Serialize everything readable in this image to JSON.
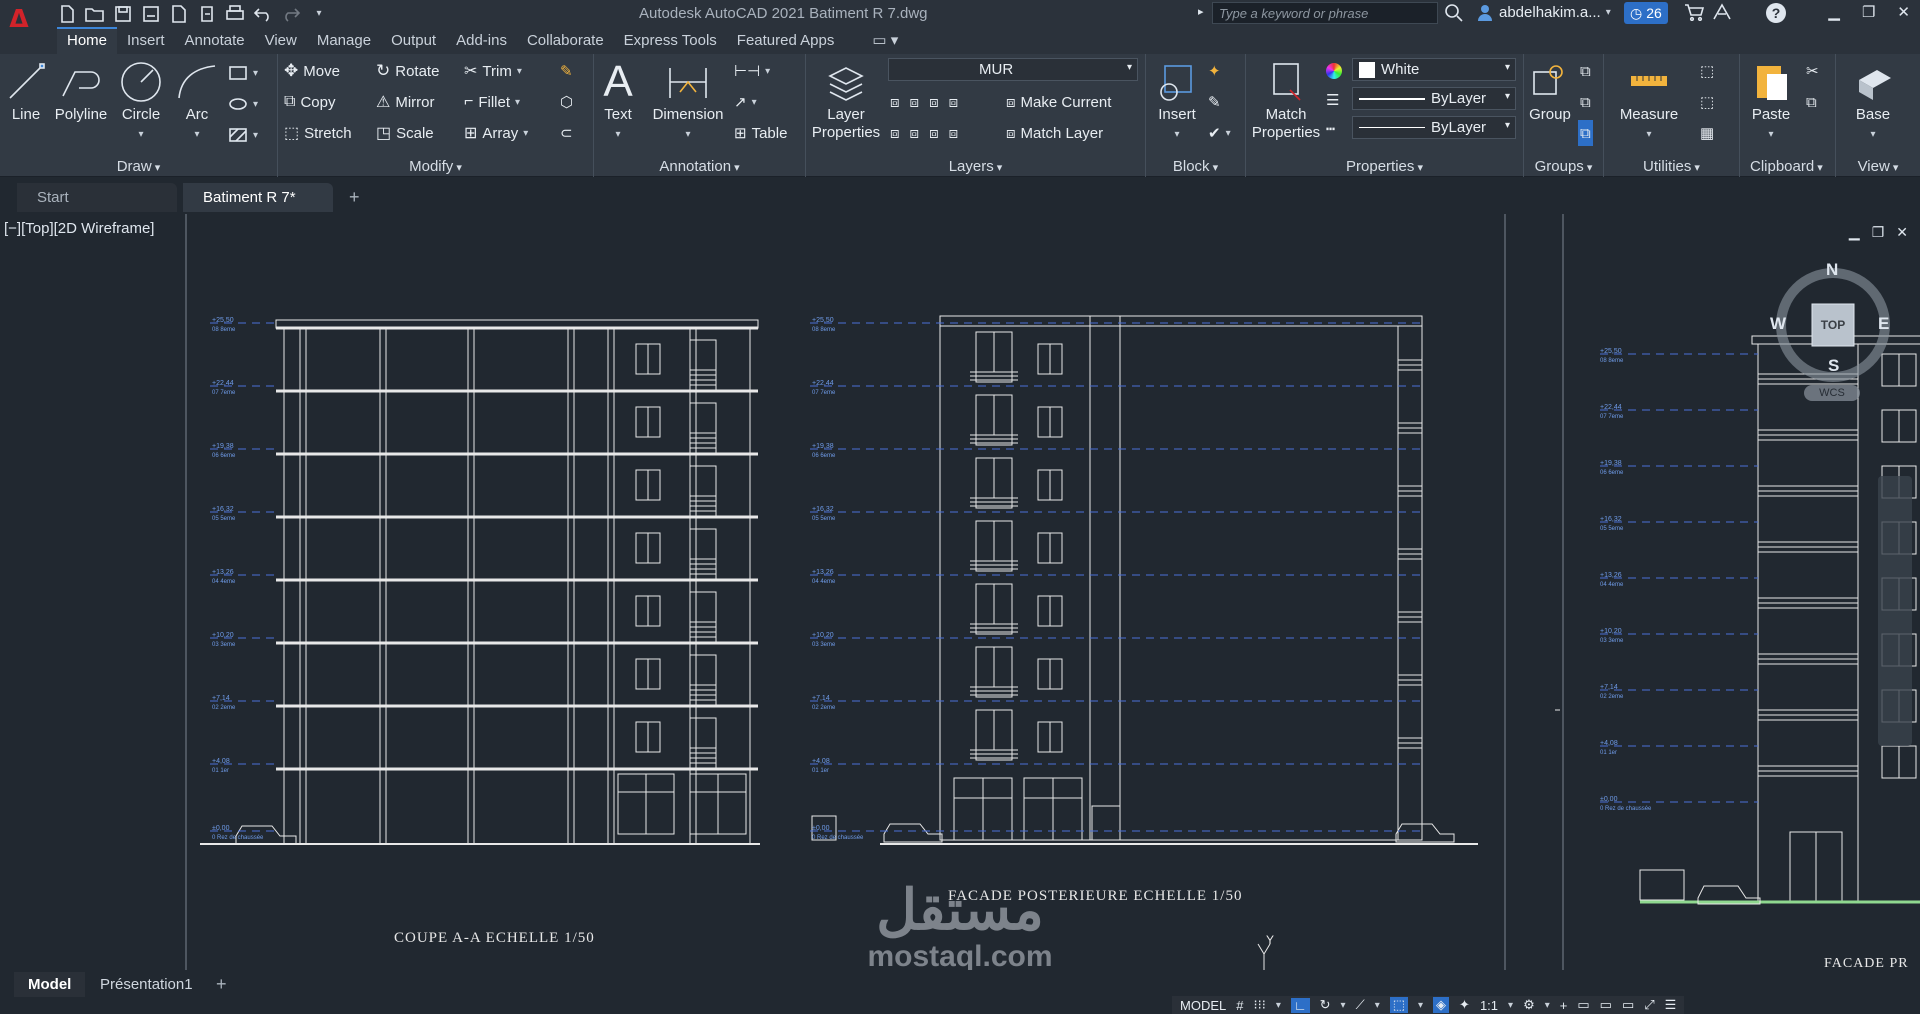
{
  "app": {
    "logo_letter": "A",
    "title": "Autodesk AutoCAD 2021   Batiment R 7.dwg",
    "search_placeholder": "Type a keyword or phrase",
    "user": "abdelhakim.a...",
    "notification_count": "26",
    "accent_color": "#2d6fc7",
    "logo_color": "#d2232a"
  },
  "ribbon_tabs": [
    "Home",
    "Insert",
    "Annotate",
    "View",
    "Manage",
    "Output",
    "Add-ins",
    "Collaborate",
    "Express Tools",
    "Featured Apps"
  ],
  "draw": {
    "title": "Draw",
    "line": "Line",
    "polyline": "Polyline",
    "circle": "Circle",
    "arc": "Arc"
  },
  "modify": {
    "title": "Modify",
    "move": "Move",
    "rotate": "Rotate",
    "trim": "Trim",
    "copy": "Copy",
    "mirror": "Mirror",
    "fillet": "Fillet",
    "stretch": "Stretch",
    "scale": "Scale",
    "array": "Array"
  },
  "annotation": {
    "title": "Annotation",
    "text": "Text",
    "dimension": "Dimension",
    "table": "Table"
  },
  "layers": {
    "title": "Layers",
    "properties": "Layer Properties",
    "current_layer": "MUR",
    "make_current": "Make Current",
    "match_layer": "Match Layer"
  },
  "block": {
    "title": "Block",
    "insert": "Insert"
  },
  "properties": {
    "title": "Properties",
    "match": "Match Properties",
    "color": "White",
    "linetype": "ByLayer",
    "lineweight": "ByLayer"
  },
  "groups": {
    "title": "Groups",
    "group": "Group"
  },
  "utilities": {
    "title": "Utilities",
    "measure": "Measure"
  },
  "clipboard": {
    "title": "Clipboard",
    "paste": "Paste"
  },
  "view": {
    "title": "View",
    "base": "Base"
  },
  "doc_tabs": {
    "start": "Start",
    "current": "Batiment R 7*"
  },
  "viewport": {
    "label": "[−][Top][2D Wireframe]",
    "navcube": {
      "top": "TOP",
      "n": "N",
      "s": "S",
      "e": "E",
      "w": "W",
      "wcs": "WCS"
    }
  },
  "drawing": {
    "caption_left": "COUPE A-A ECHELLE 1/50",
    "caption_center": "FACADE POSTERIEURE ECHELLE 1/50",
    "caption_right": "FACADE PR",
    "ucs_y": "Y",
    "levels_left": [
      {
        "value": "+25,50",
        "name": "08 8eme"
      },
      {
        "value": "+22,44",
        "name": "07 7eme"
      },
      {
        "value": "+19,38",
        "name": "06 6eme"
      },
      {
        "value": "+16,32",
        "name": "05 5eme"
      },
      {
        "value": "+13,26",
        "name": "04 4eme"
      },
      {
        "value": "+10,20",
        "name": "03 3eme"
      },
      {
        "value": "+7,14",
        "name": "02 2eme"
      },
      {
        "value": "+4,08",
        "name": "01 1er"
      },
      {
        "value": "±0,00",
        "name": "0 Rez de chaussée"
      }
    ]
  },
  "layout_tabs": {
    "model": "Model",
    "presentation": "Présentation1"
  },
  "status": {
    "mode": "MODEL",
    "scale": "1:1"
  },
  "watermark": {
    "arabic": "مستقل",
    "latin": "mostaql.com"
  }
}
